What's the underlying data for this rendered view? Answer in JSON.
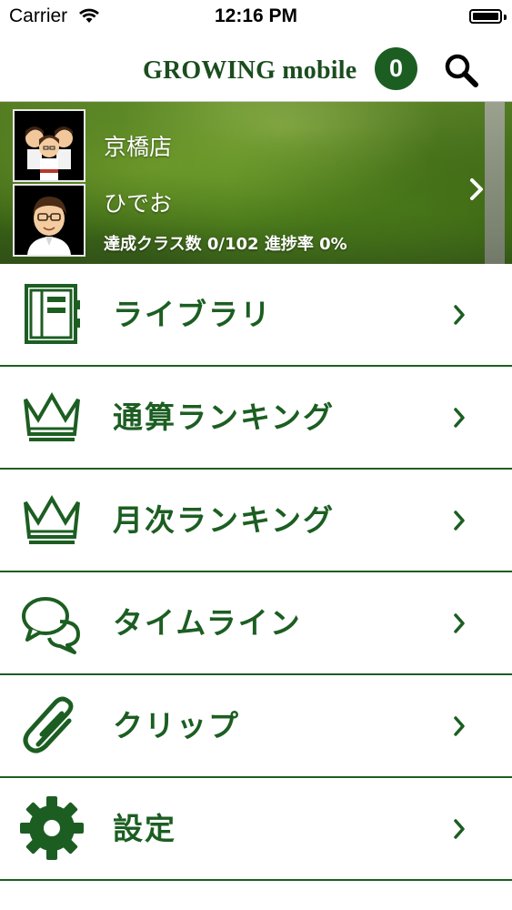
{
  "status_bar": {
    "carrier": "Carrier",
    "time": "12:16 PM"
  },
  "nav": {
    "brand": "GROWING mobile",
    "badge_count": "0",
    "icons": [
      "search-icon"
    ]
  },
  "profile": {
    "store_name": "京橋店",
    "user_name": "ひでお",
    "progress": "達成クラス数 0/102 進捗率 0%"
  },
  "menu": {
    "items": [
      {
        "label": "ライブラリ",
        "icon": "notebook-icon"
      },
      {
        "label": "通算ランキング",
        "icon": "crown-icon"
      },
      {
        "label": "月次ランキング",
        "icon": "crown-icon"
      },
      {
        "label": "タイムライン",
        "icon": "chat-bubbles-icon"
      },
      {
        "label": "クリップ",
        "icon": "paperclip-icon"
      },
      {
        "label": "設定",
        "icon": "gear-icon"
      }
    ]
  },
  "colors": {
    "brand_green": "#1c5e22",
    "divider": "#1c5e22",
    "background": "#ffffff"
  }
}
